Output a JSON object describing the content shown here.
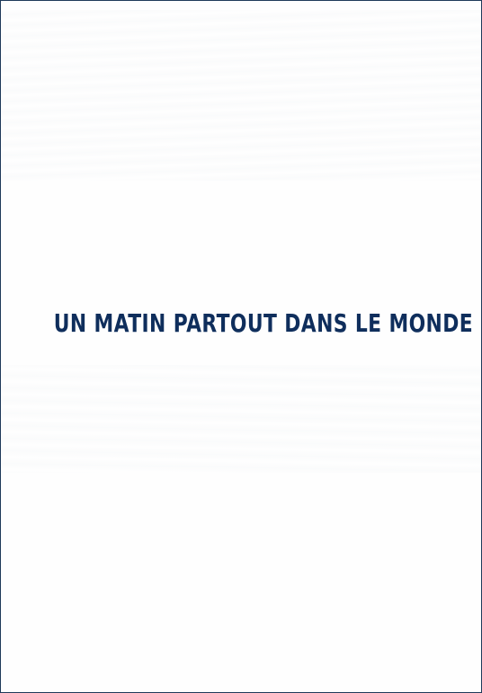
{
  "title": "UN MATIN PARTOUT DANS LE MONDE",
  "colors": {
    "title_text": "#0f2e5c",
    "background": "#fefefe",
    "border": "#1f3a5a"
  }
}
